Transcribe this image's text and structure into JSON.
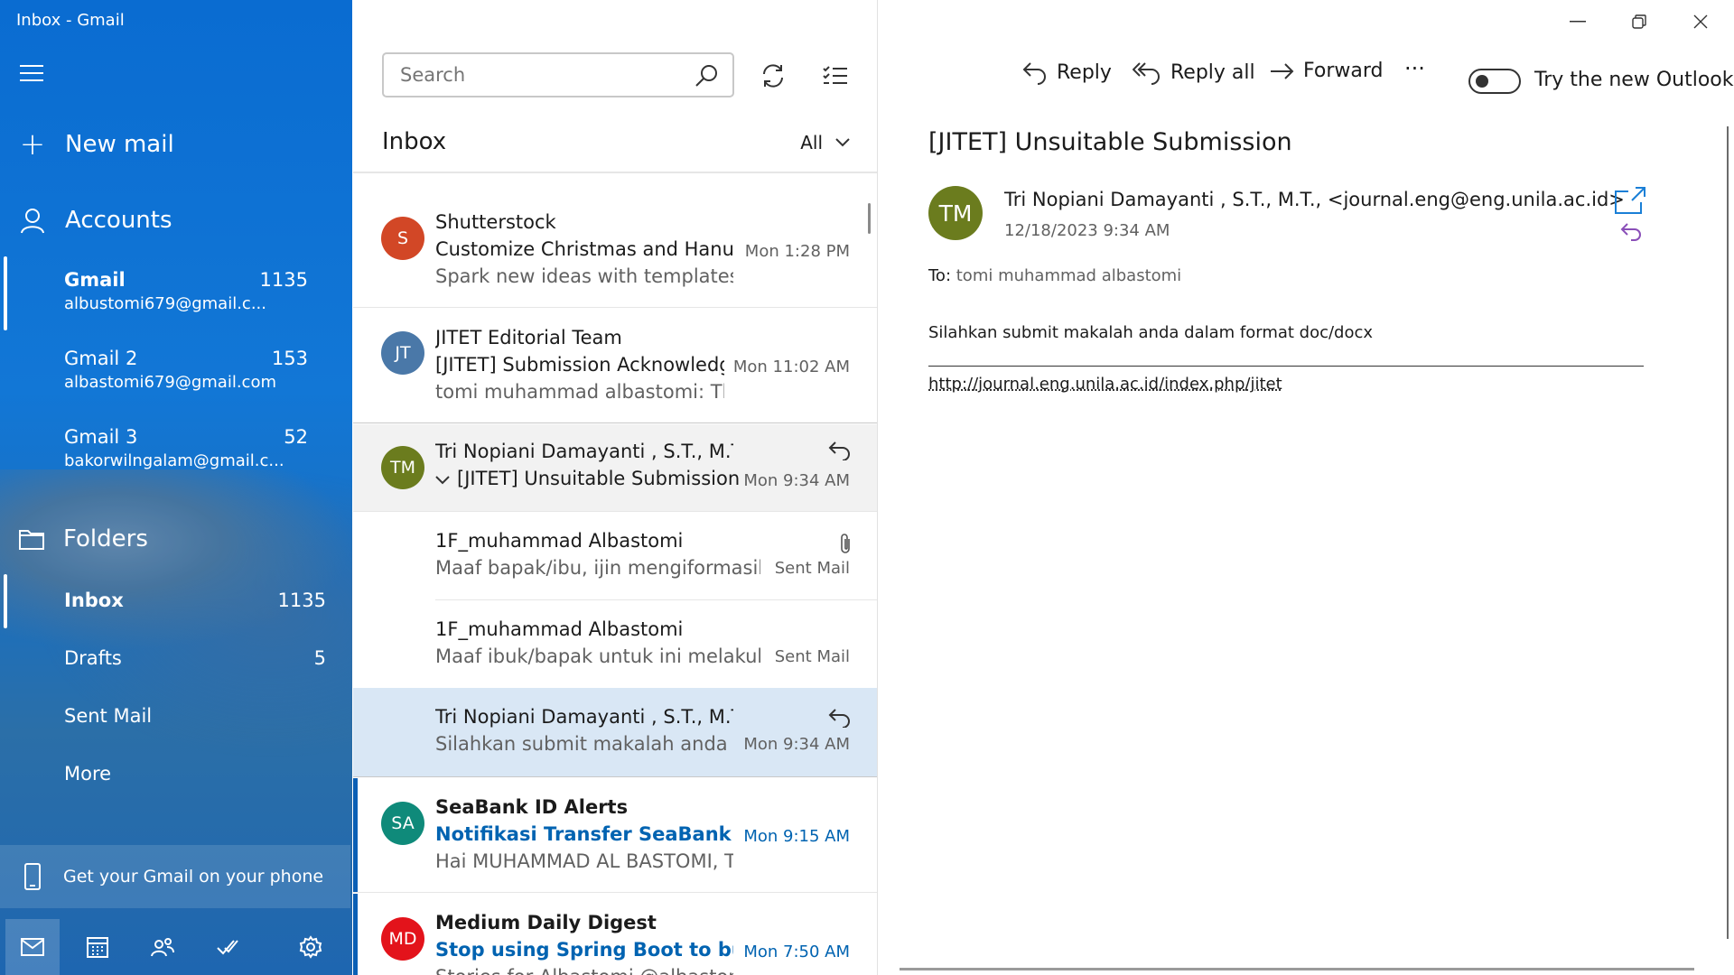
{
  "nav": {
    "title": "Inbox - Gmail",
    "new_mail": "New mail",
    "accounts_label": "Accounts",
    "accounts": [
      {
        "name": "Gmail",
        "count": "1135",
        "email": "albustomi679@gmail.c..."
      },
      {
        "name": "Gmail 2",
        "count": "153",
        "email": "albastomi679@gmail.com"
      },
      {
        "name": "Gmail 3",
        "count": "52",
        "email": "bakorwilngalam@gmail.c..."
      }
    ],
    "folders_label": "Folders",
    "folders": [
      {
        "name": "Inbox",
        "count": "1135"
      },
      {
        "name": "Drafts",
        "count": "5"
      },
      {
        "name": "Sent Mail",
        "count": ""
      },
      {
        "name": "More",
        "count": ""
      }
    ],
    "phone_promo": "Get your Gmail on your phone",
    "bottom_icons": [
      "mail-icon",
      "calendar-icon",
      "people-icon",
      "todo-icon",
      "settings-icon"
    ]
  },
  "list": {
    "search_placeholder": "Search",
    "title": "Inbox",
    "filter": "All",
    "messages": [
      {
        "avatar": "S",
        "avatar_color": "#d24726",
        "sender": "Shutterstock",
        "subject": "Customize Christmas and Hanukkah",
        "preview": "Spark new ideas with templates from",
        "time": "Mon 1:28 PM"
      },
      {
        "avatar": "JT",
        "avatar_color": "#4a78a8",
        "sender": "JITET Editorial Team",
        "subject": "[JITET] Submission Acknowledgement",
        "preview": "tomi muhammad albastomi: Thank",
        "time": "Mon 11:02 AM"
      },
      {
        "avatar": "TM",
        "avatar_color": "#6b7c1e",
        "sender": "Tri Nopiani Damayanti , S.T., M.T.,",
        "subject": "[JITET] Unsuitable Submission",
        "time": "Mon 9:34 AM"
      },
      {
        "sender": "1F_muhammad Albastomi",
        "preview": "Maaf bapak/ibu, ijin mengiformasikan",
        "time": "Sent Mail"
      },
      {
        "sender": "1F_muhammad Albastomi",
        "preview": "Maaf ibuk/bapak untuk ini melakukan",
        "time": "Sent Mail"
      },
      {
        "sender": "Tri Nopiani Damayanti , S.T., M.T.,",
        "preview": "Silahkan submit makalah anda dalam",
        "time": "Mon 9:34 AM"
      },
      {
        "avatar": "SA",
        "avatar_color": "#0f8a7a",
        "sender": "SeaBank ID Alerts",
        "subject": "Notifikasi Transfer SeaBank",
        "preview": "Hai MUHAMMAD AL BASTOMI, Transfer",
        "time": "Mon 9:15 AM"
      },
      {
        "avatar": "MD",
        "avatar_color": "#e3131b",
        "sender": "Medium Daily Digest",
        "subject": "Stop using Spring Boot to build",
        "preview": "Stories for Albastomi @albastomi",
        "time": "Mon 7:50 AM"
      }
    ]
  },
  "reader": {
    "actions": {
      "reply": "Reply",
      "reply_all": "Reply all",
      "forward": "Forward",
      "more": "···"
    },
    "toggle_label": "Try the new Outlook",
    "subject": "[JITET] Unsuitable Submission",
    "avatar": "TM",
    "sender": "Tri Nopiani Damayanti , S.T., M.T., <journal.eng@eng.unila.ac.id>",
    "date": "12/18/2023 9:34 AM",
    "to_label": "To:",
    "to_value": "tomi muhammad albastomi",
    "body": "Silahkan submit makalah anda dalam format doc/docx",
    "link": "http://journal.eng.unila.ac.id/index.php/jitet"
  }
}
